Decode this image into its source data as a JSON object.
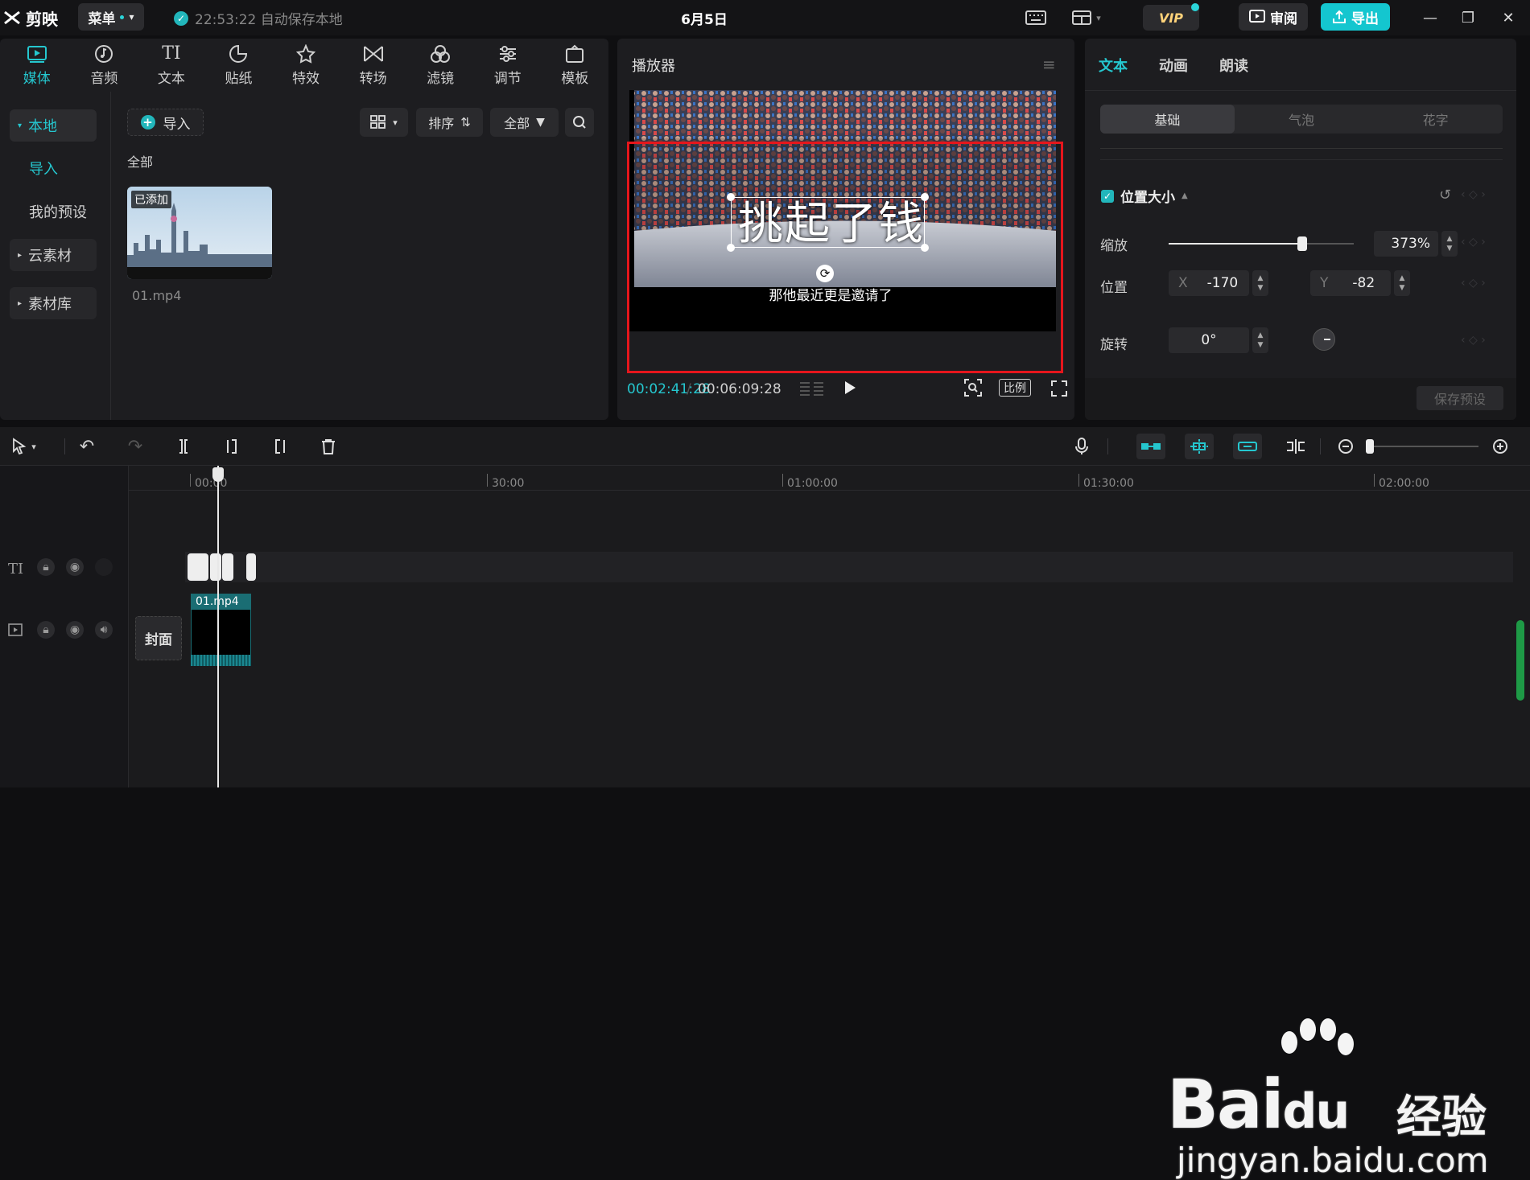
{
  "titlebar": {
    "app_name": "剪映",
    "menu_label": "菜单",
    "autosave_text": "22:53:22 自动保存本地",
    "project_title": "6月5日",
    "vip_label": "VIP",
    "review_label": "审阅",
    "export_label": "导出"
  },
  "media_panel": {
    "tools": [
      {
        "label": "媒体",
        "icon": "media-icon"
      },
      {
        "label": "音频",
        "icon": "audio-icon"
      },
      {
        "label": "文本",
        "icon": "text-icon"
      },
      {
        "label": "贴纸",
        "icon": "sticker-icon"
      },
      {
        "label": "特效",
        "icon": "effects-icon"
      },
      {
        "label": "转场",
        "icon": "transition-icon"
      },
      {
        "label": "滤镜",
        "icon": "filter-icon"
      },
      {
        "label": "调节",
        "icon": "adjust-icon"
      },
      {
        "label": "模板",
        "icon": "template-icon"
      }
    ],
    "sidebar": {
      "local": "本地",
      "import": "导入",
      "my_presets": "我的预设",
      "cloud": "云素材",
      "library": "素材库"
    },
    "import_label": "导入",
    "sort_label": "排序",
    "filter_label": "全部",
    "all_label": "全部",
    "clip": {
      "badge": "已添加",
      "name": "01.mp4"
    }
  },
  "player": {
    "title": "播放器",
    "overlay_text": "挑起了钱",
    "subtitle_text": "那他最近更是邀请了",
    "current_time": "00:02:41:28",
    "total_time": "00:06:09:28",
    "time_separator": "/",
    "ratio_label": "比例"
  },
  "properties": {
    "tabs": [
      "文本",
      "动画",
      "朗读"
    ],
    "subtabs": [
      "基础",
      "气泡",
      "花字"
    ],
    "section_title": "位置大小",
    "scale_label": "缩放",
    "scale_value": "373%",
    "scale_fraction": 0.72,
    "position_label": "位置",
    "x_label": "X",
    "x_value": "-170",
    "y_label": "Y",
    "y_value": "-82",
    "rotation_label": "旋转",
    "rotation_value": "0°",
    "save_preset_label": "保存预设"
  },
  "timeline": {
    "ruler_ticks": [
      "00:00",
      "30:00",
      "01:00:00",
      "01:30:00",
      "02:00:00"
    ],
    "video_clip_name": "01.mp4",
    "cover_label": "封面"
  },
  "watermark": {
    "brand": "Bai",
    "brand2": "du",
    "product": "经验",
    "url": "jingyan.baidu.com"
  },
  "colors": {
    "accent": "#25c7cf",
    "selection": "#e6161c"
  }
}
